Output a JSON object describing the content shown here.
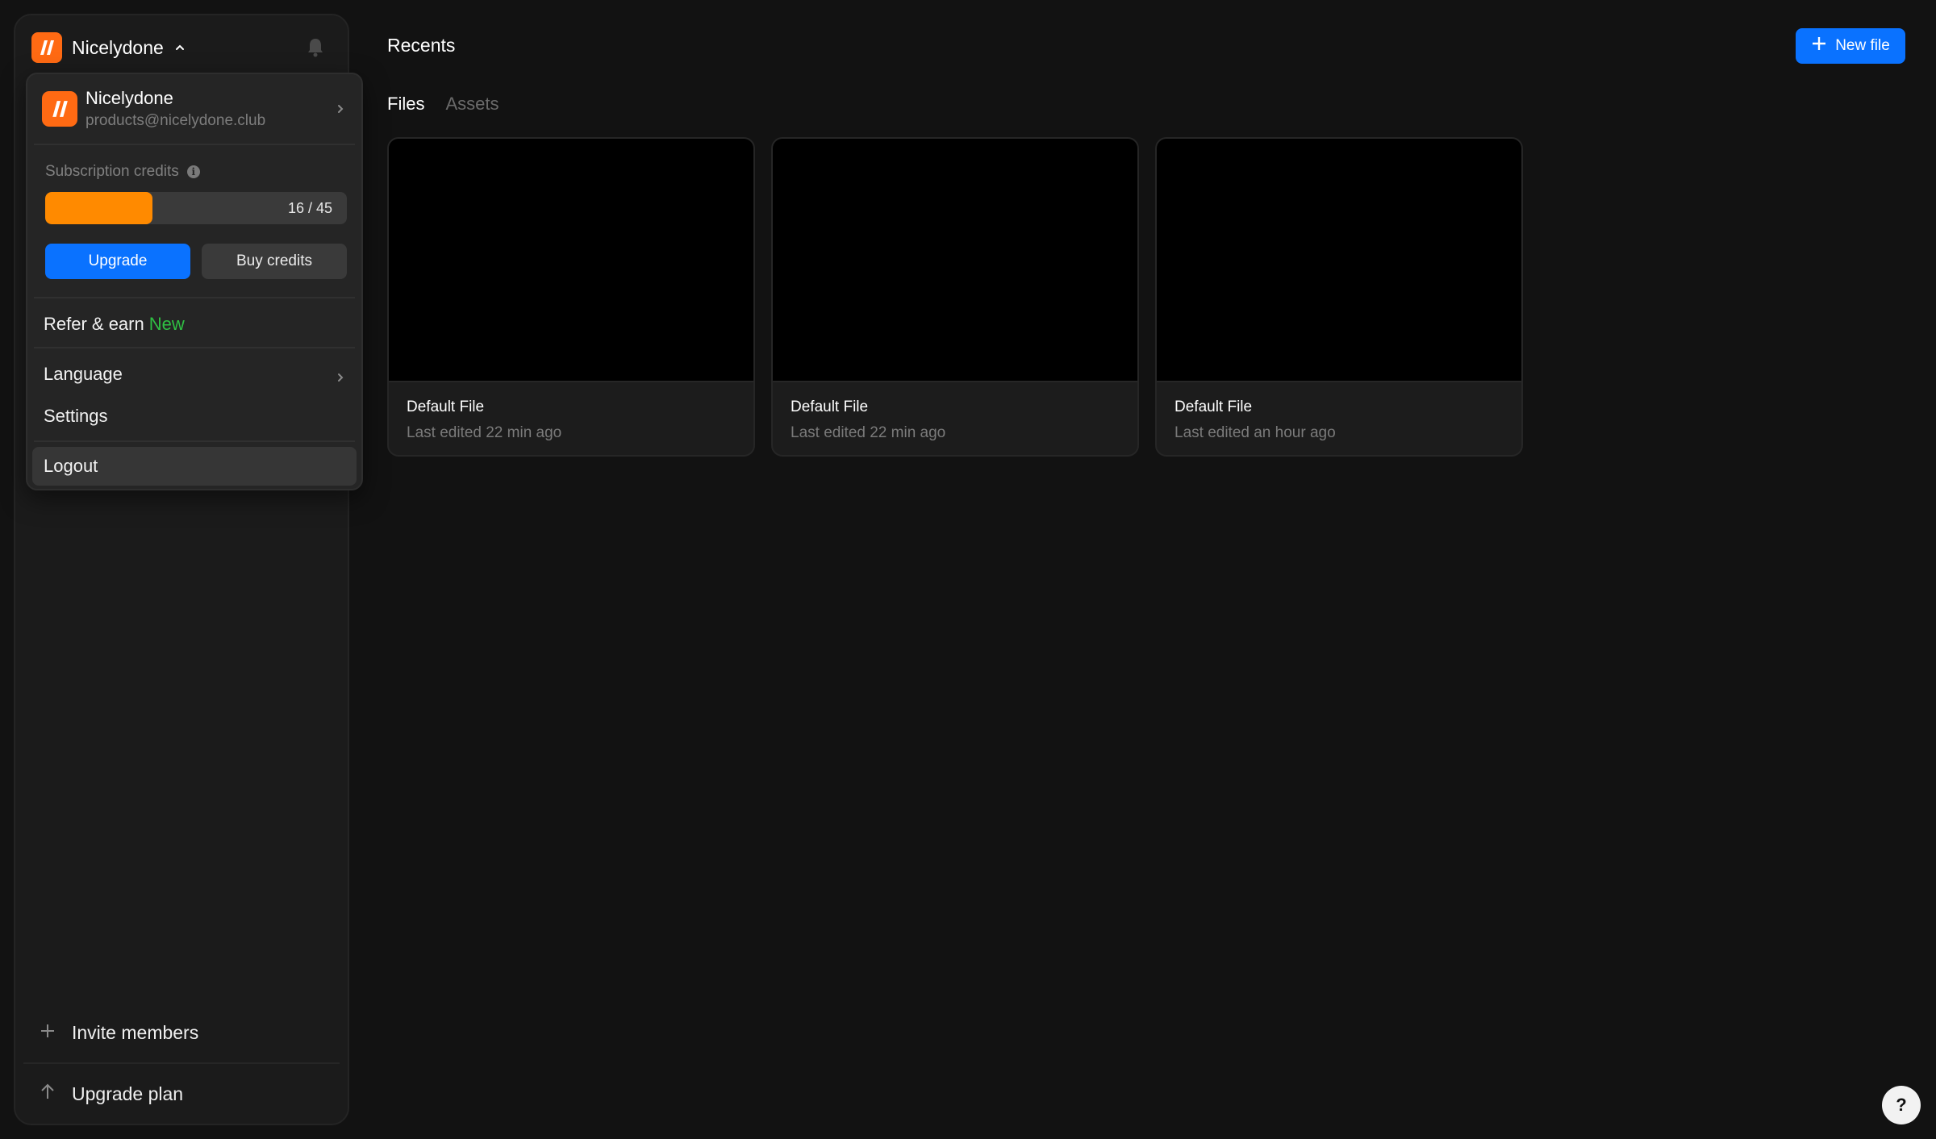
{
  "workspace": {
    "name": "Nicelydone"
  },
  "menu": {
    "account_name": "Nicelydone",
    "account_email": "products@nicelydone.club",
    "credits_label": "Subscription credits",
    "credits_used": 16,
    "credits_total": 45,
    "credits_text": "16 / 45",
    "upgrade_label": "Upgrade",
    "buy_credits_label": "Buy credits",
    "refer_label": "Refer & earn",
    "refer_badge": "New",
    "language_label": "Language",
    "settings_label": "Settings",
    "logout_label": "Logout"
  },
  "sidebar_bottom": {
    "invite_label": "Invite members",
    "upgrade_plan_label": "Upgrade plan"
  },
  "main": {
    "title": "Recents",
    "new_file_label": "New file",
    "tabs": [
      {
        "label": "Files",
        "active": true
      },
      {
        "label": "Assets",
        "active": false
      }
    ],
    "files": [
      {
        "name": "Default File",
        "edited": "Last edited 22 min ago"
      },
      {
        "name": "Default File",
        "edited": "Last edited 22 min ago"
      },
      {
        "name": "Default File",
        "edited": "Last edited an hour ago"
      }
    ]
  },
  "help_label": "?",
  "colors": {
    "accent_blue": "#0a72ff",
    "brand_orange": "#ff6a13",
    "progress_orange": "#ff8a00",
    "new_green": "#2fbf43"
  }
}
